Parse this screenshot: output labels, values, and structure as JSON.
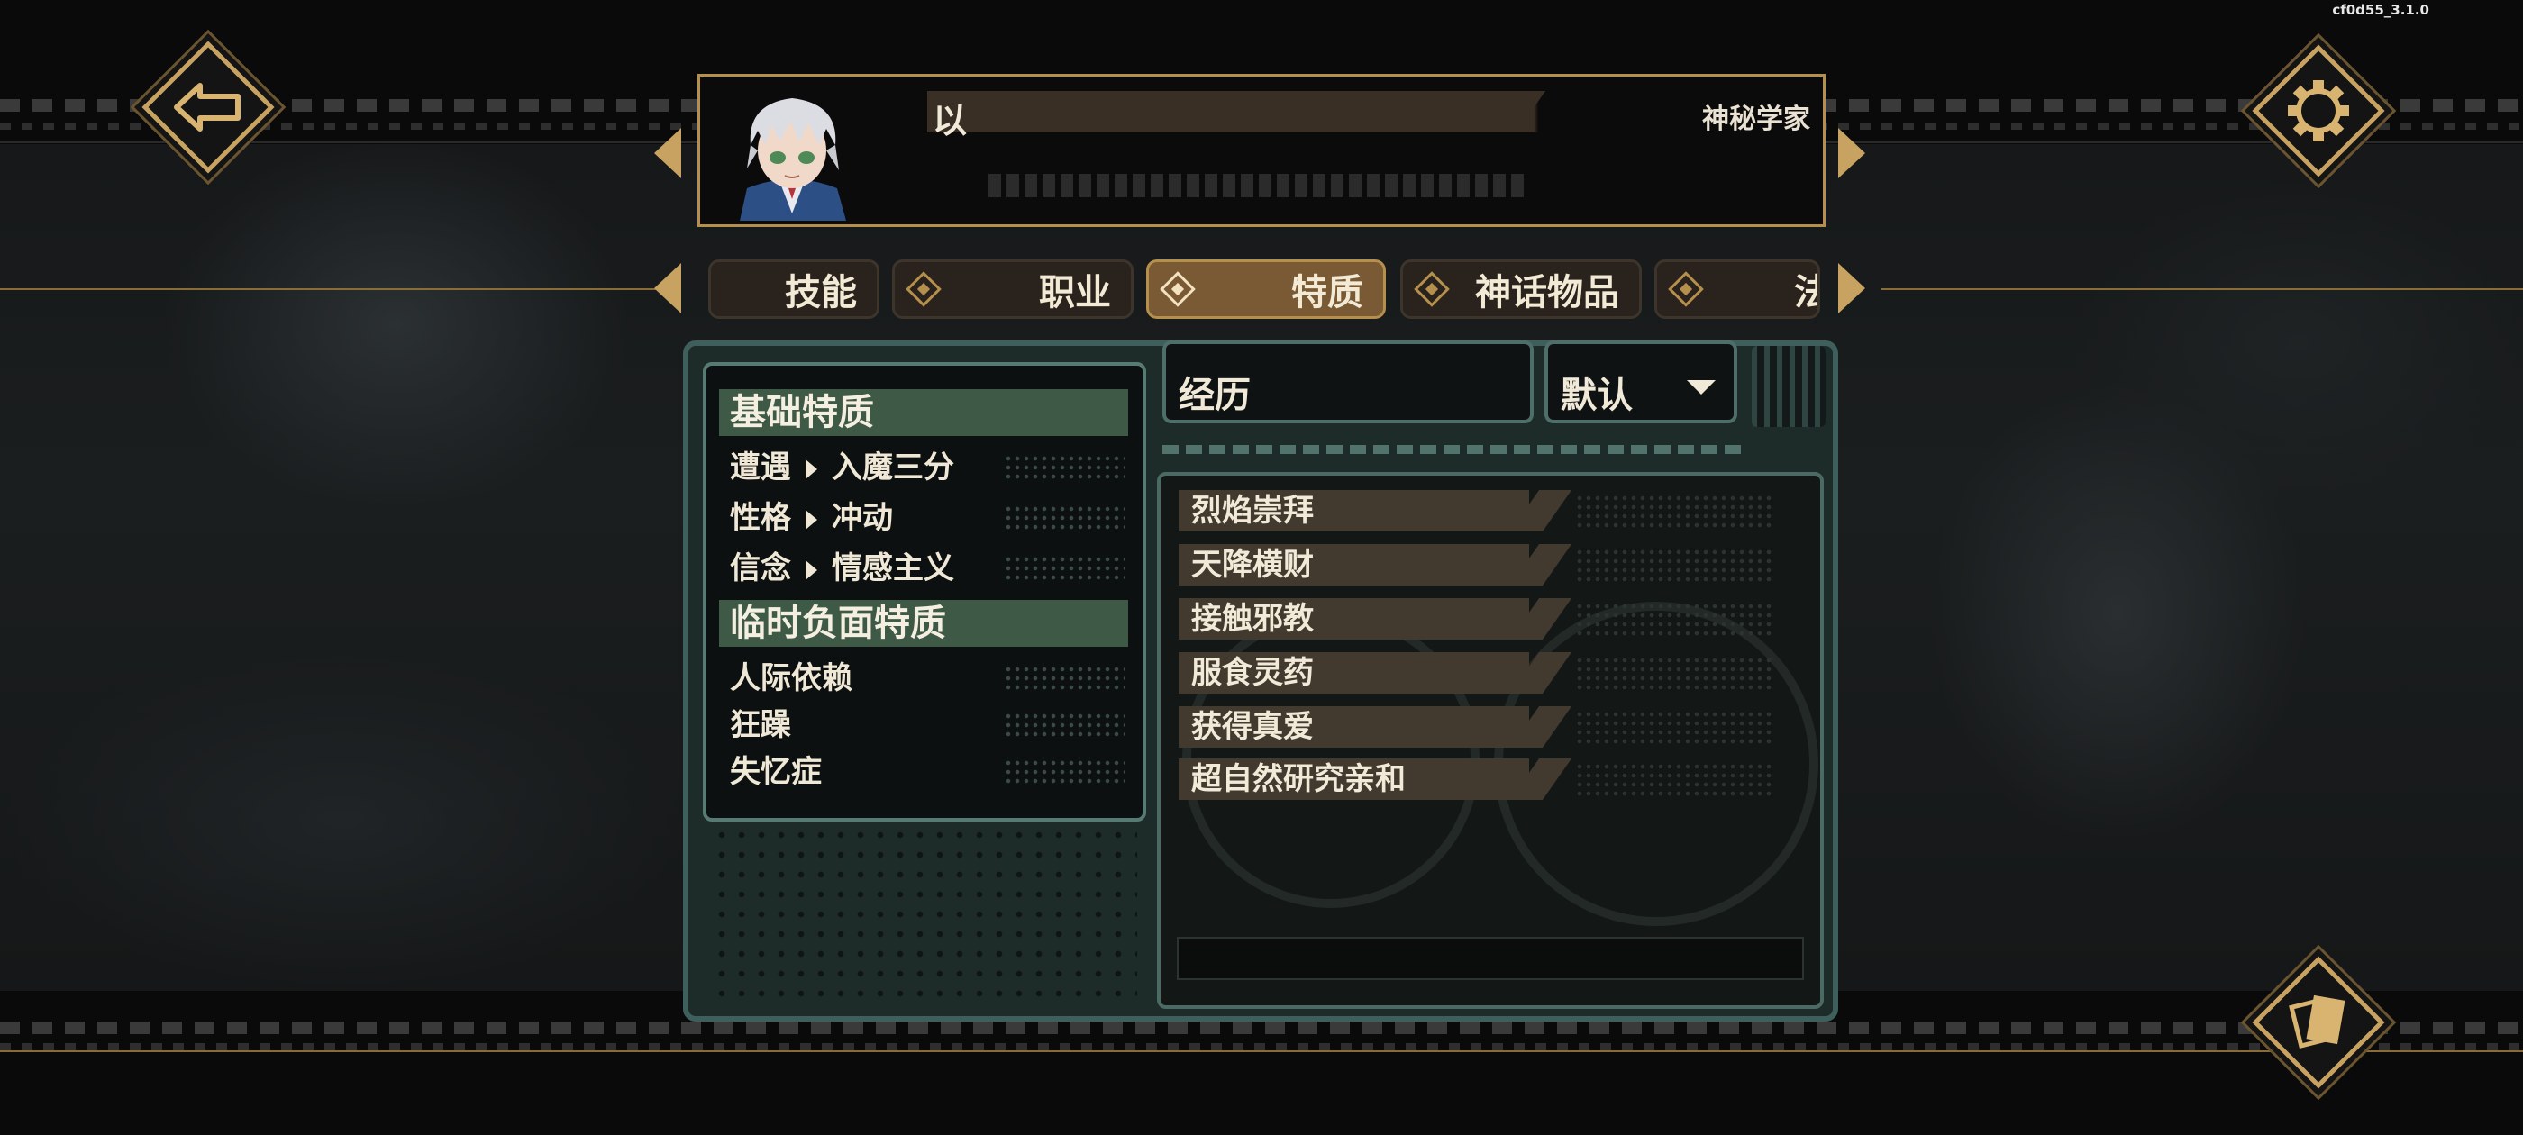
{
  "version": "cf0d55_3.1.0",
  "header": {
    "character_name": "以",
    "character_title": "神秘学家"
  },
  "tabs": [
    {
      "label": "技能",
      "active": false
    },
    {
      "label": "职业",
      "active": false
    },
    {
      "label": "特质",
      "active": true
    },
    {
      "label": "神话物品",
      "active": false
    },
    {
      "label": "法",
      "active": false
    }
  ],
  "traits": {
    "basic_title": "基础特质",
    "basic": [
      {
        "label": "遭遇",
        "value": "入魔三分"
      },
      {
        "label": "性格",
        "value": "冲动"
      },
      {
        "label": "信念",
        "value": "情感主义"
      }
    ],
    "temp_title": "临时负面特质",
    "temp": [
      "人际依赖",
      "狂躁",
      "失忆症"
    ]
  },
  "filter": {
    "search_value": "经历",
    "sort_value": "默认"
  },
  "experience_list": [
    "烈焰崇拜",
    "天降横财",
    "接触邪教",
    "服食灵药",
    "获得真爱",
    "超自然研究亲和"
  ],
  "icons": {
    "back": "back-arrow-icon",
    "settings": "gear-icon",
    "cards": "cards-icon",
    "tab_marker": "diamond-icon",
    "sort_caret": "caret-down-icon"
  },
  "colors": {
    "gold": "#c8a260",
    "teal_frame": "#3e5f5b",
    "section_green": "#3e5a47",
    "item_brown": "#433a2f",
    "active_tab": "#7a5a34"
  }
}
